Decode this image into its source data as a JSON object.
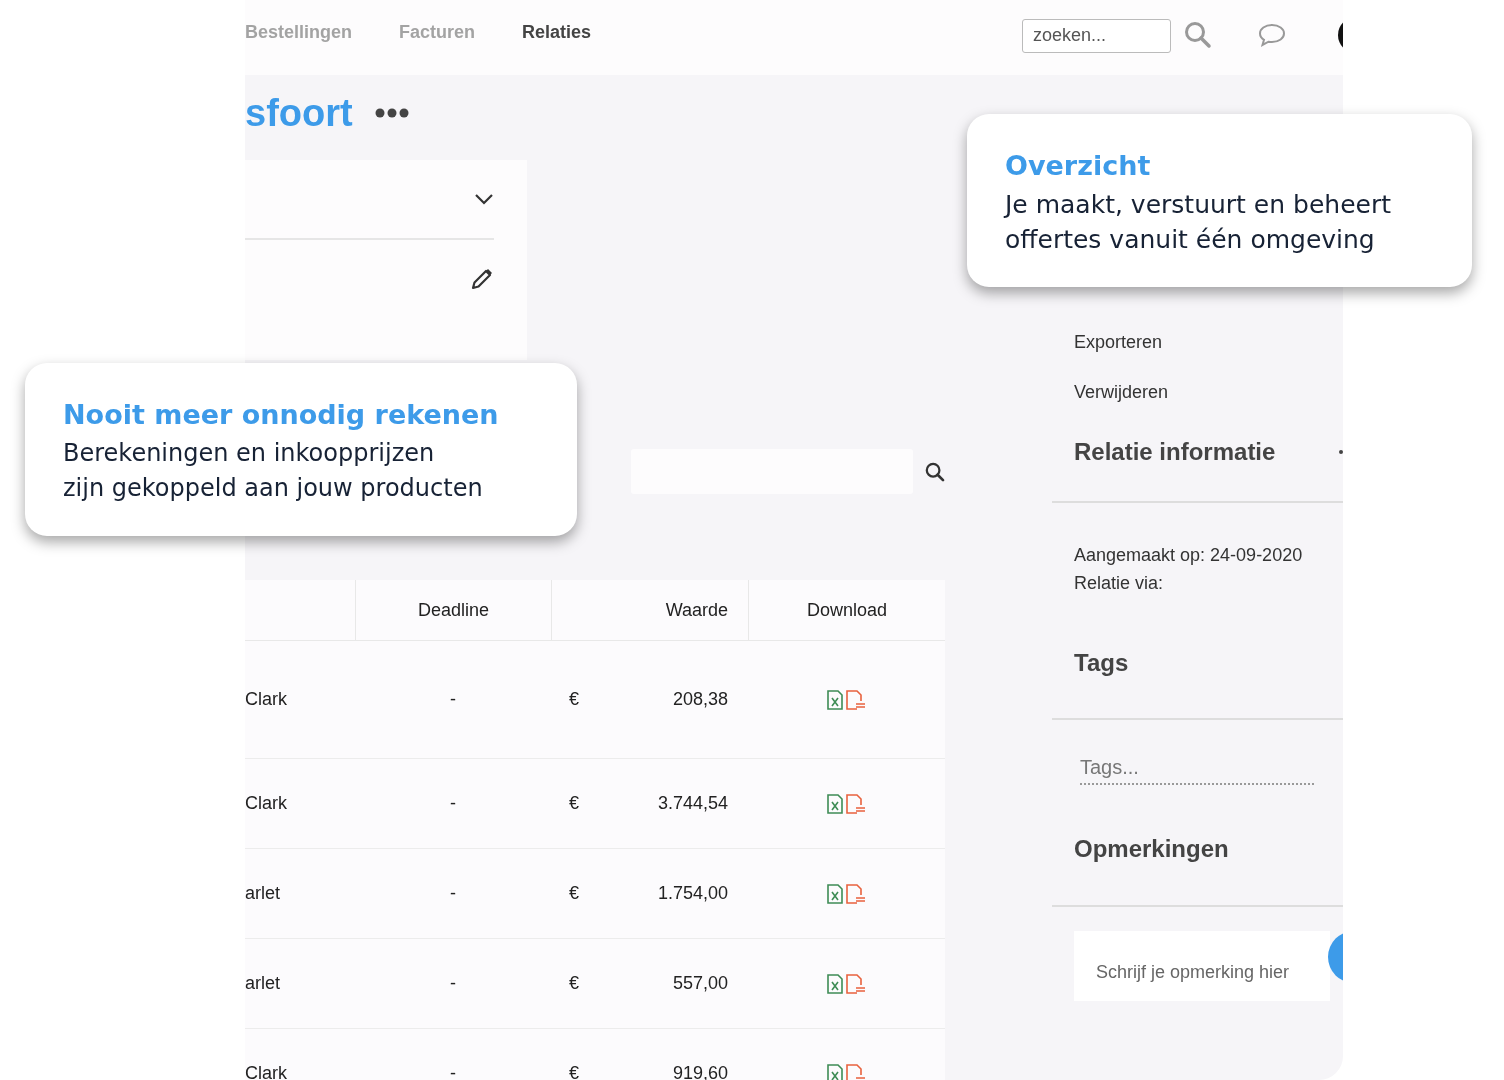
{
  "nav": {
    "tabs": [
      {
        "label": "Bestellingen",
        "selected": false
      },
      {
        "label": "Facturen",
        "selected": false
      },
      {
        "label": "Relaties",
        "selected": true
      }
    ],
    "search": {
      "placeholder": "zoeken..."
    }
  },
  "page_title": "sfoort",
  "table": {
    "columns": [
      "Deadline",
      "Waarde",
      "Download"
    ],
    "rows": [
      {
        "column_1": "Clark",
        "deadline": "-",
        "currency": "€",
        "value": "208,38"
      },
      {
        "column_1": "Clark",
        "deadline": "-",
        "currency": "€",
        "value": "3.744,54"
      },
      {
        "column_1": "arlet",
        "deadline": "-",
        "currency": "€",
        "value": "1.754,00"
      },
      {
        "column_1": "arlet",
        "deadline": "-",
        "currency": "€",
        "value": "557,00"
      },
      {
        "column_1": "Clark",
        "deadline": "-",
        "currency": "€",
        "value": "919,60"
      }
    ]
  },
  "sidebar": {
    "actions": [
      "Exporteren",
      "Verwijderen"
    ],
    "relation_heading": "Relatie informatie",
    "info": [
      "Aangemaakt op: 24-09-2020",
      "Relatie via:"
    ],
    "tags_heading": "Tags",
    "tags_field": {
      "placeholder": "Tags..."
    },
    "notes_heading": "Opmerkingen",
    "notes_field": {
      "placeholder": "Schrijf je opmerking hier"
    }
  },
  "callouts": [
    {
      "title": "Overzicht",
      "lines": [
        "Je maakt, verstuurt en beheert",
        "offertes vanuit één omgeving"
      ]
    },
    {
      "title": "Nooit meer onnodig rekenen",
      "lines": [
        "Berekeningen en inkoopprijzen",
        "zijn gekoppeld aan jouw producten"
      ]
    }
  ]
}
